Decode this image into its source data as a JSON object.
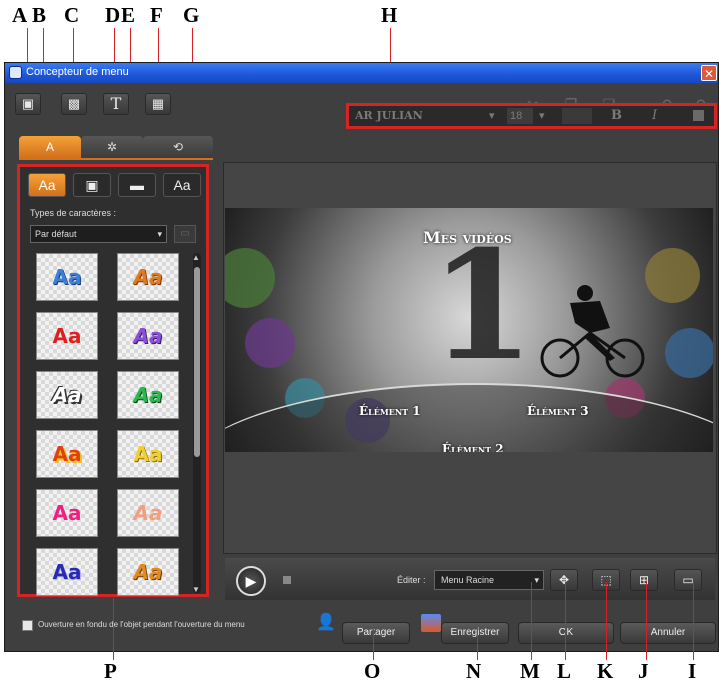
{
  "callouts": {
    "top": [
      "A",
      "B",
      "C",
      "D",
      "E",
      "F",
      "G",
      "H"
    ],
    "bottom": [
      "P",
      "O",
      "N",
      "M",
      "L",
      "K",
      "J",
      "I"
    ]
  },
  "window": {
    "title": "Concepteur de menu",
    "close_glyph": "✕"
  },
  "toolbar": {
    "icons": [
      "folder-search-icon",
      "image-icon",
      "text-icon",
      "chapter-icon"
    ],
    "right_icons": [
      "cut-icon",
      "copy-icon",
      "paste-icon",
      "undo-icon",
      "redo-icon"
    ]
  },
  "tabs": [
    {
      "icon": "text-style-icon",
      "glyph": "A",
      "active": true
    },
    {
      "icon": "motion-path-icon",
      "glyph": "✲",
      "active": false
    },
    {
      "icon": "transition-icon",
      "glyph": "⟲",
      "active": false
    }
  ],
  "format_bar": {
    "font": "AR JULIAN",
    "size": "18",
    "bold": "B",
    "italic": "I"
  },
  "left_panel": {
    "subtabs": [
      "Aa",
      "",
      "",
      "Aa"
    ],
    "types_label": "Types de caractères :",
    "type_select": "Par défaut",
    "samples": [
      {
        "text": "Aa",
        "color": "#3b7fd6"
      },
      {
        "text": "Aa",
        "color": "#e07a1a"
      },
      {
        "text": "Aa",
        "color": "#e02020"
      },
      {
        "text": "Aa",
        "color": "#8a4ed8"
      },
      {
        "text": "Aa",
        "color": "#ffffff"
      },
      {
        "text": "Aa",
        "color": "#2cb84a"
      },
      {
        "text": "Aa",
        "color": "#e04010"
      },
      {
        "text": "Aa",
        "color": "#f0d030"
      },
      {
        "text": "Aa",
        "color": "#f02080"
      },
      {
        "text": "Aa",
        "color": "#f0a080"
      },
      {
        "text": "Aa",
        "color": "#2a2ab0"
      },
      {
        "text": "Aa",
        "color": "#e08a20"
      }
    ]
  },
  "preview": {
    "title": "Mes vidéos",
    "big_number": "1",
    "items": [
      "Élément 1",
      "Élément 3",
      "Élément 2"
    ],
    "nav_glyphs": [
      "⌂",
      "↺",
      "‹",
      "›"
    ]
  },
  "playback": {
    "play_glyph": "▶",
    "edit_label": "Éditer :",
    "edit_value": "Menu Racine"
  },
  "footer": {
    "checkbox_label": "Ouverture en fondu de l'objet pendant l'ouverture du menu",
    "share": "Partager",
    "save": "Enregistrer",
    "ok": "OK",
    "cancel": "Annuler"
  }
}
